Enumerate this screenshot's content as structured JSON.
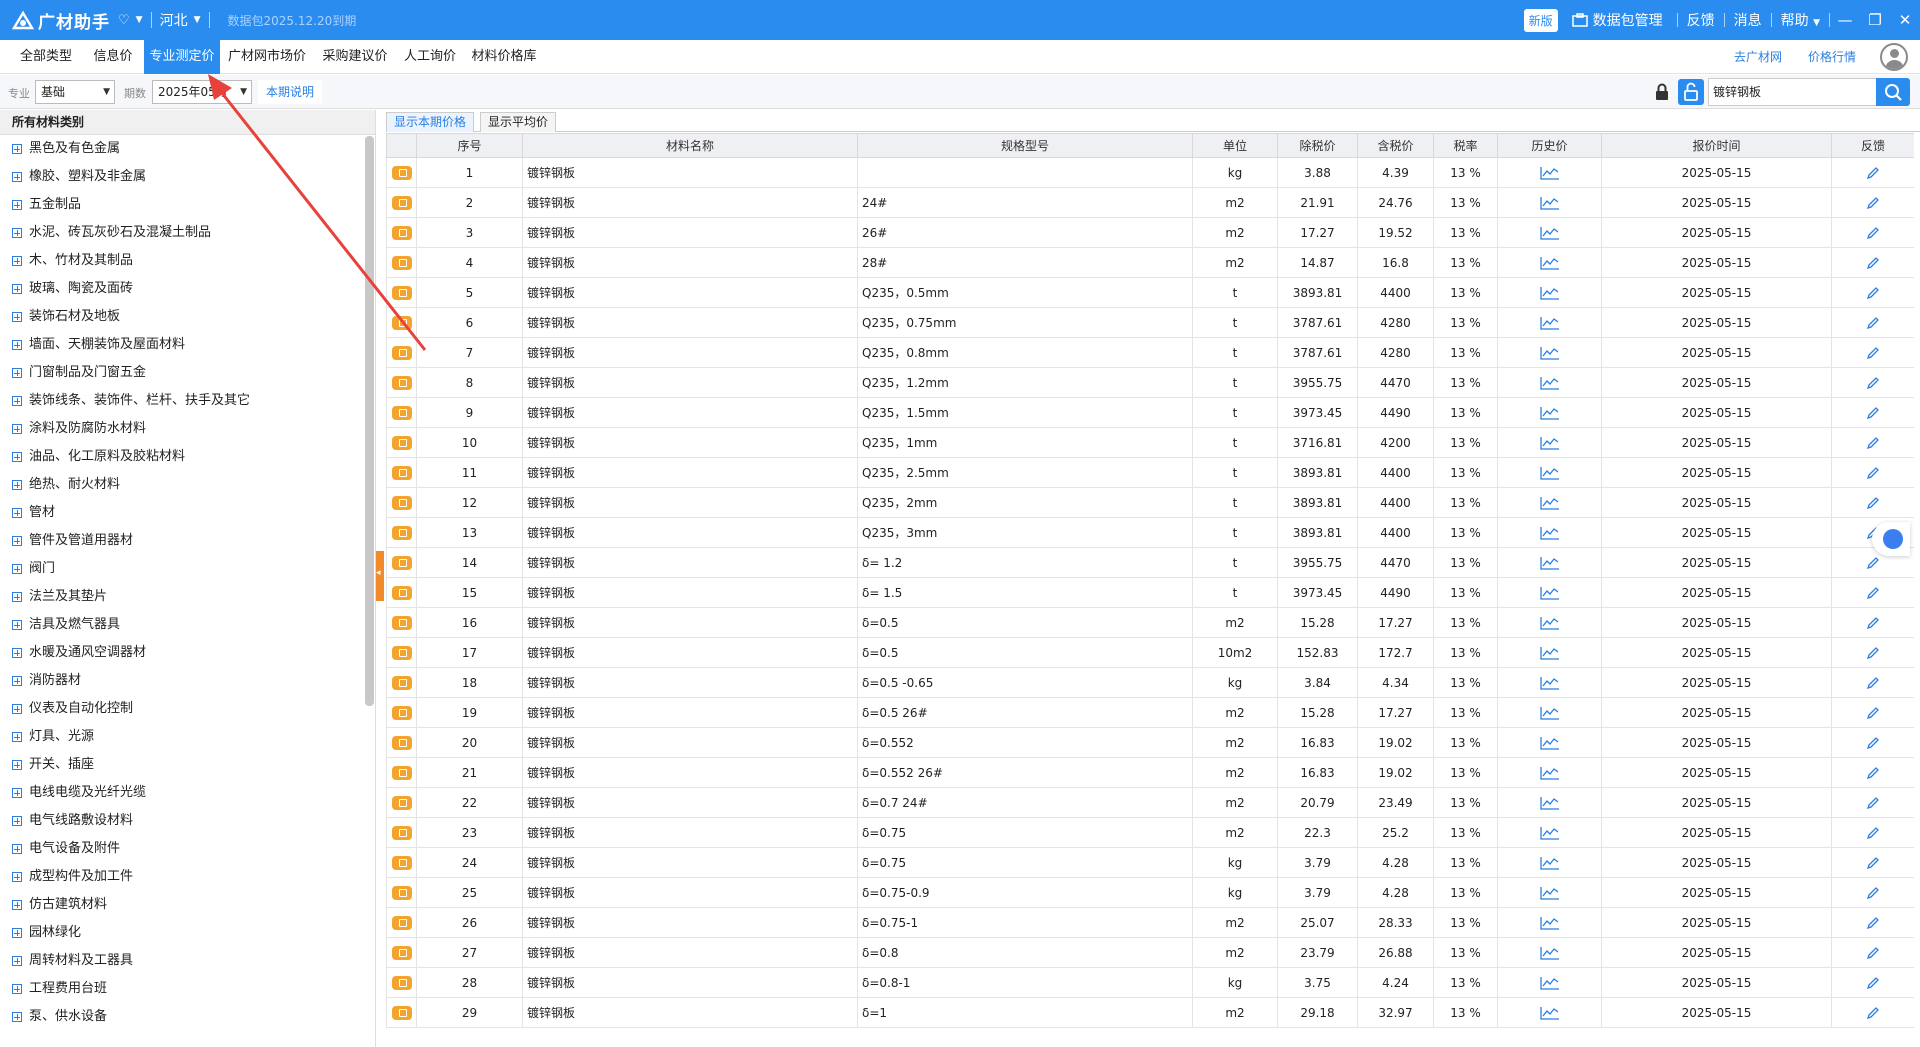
{
  "app": {
    "name": "广材助手",
    "region": "河北",
    "data_package_expire": "数据包2025.12.20到期",
    "new_badge": "新版",
    "data_package_manage": "数据包管理",
    "feedback": "反馈",
    "messages": "消息",
    "help": "帮助"
  },
  "menu": {
    "tabs": [
      "全部类型",
      "信息价",
      "专业测定价",
      "广材网市场价",
      "采购建议价",
      "人工询价",
      "材料价格库"
    ],
    "active_index": 2,
    "goto_site": "去广材网",
    "price_trend": "价格行情"
  },
  "filter": {
    "specialty_label": "专业",
    "specialty_value": "基础",
    "period_label": "期数",
    "period_value": "2025年05月",
    "explain_link": "本期说明",
    "search_value": "镀锌钢板"
  },
  "sidebar": {
    "title": "所有材料类别",
    "items": [
      "黑色及有色金属",
      "橡胶、塑料及非金属",
      "五金制品",
      "水泥、砖瓦灰砂石及混凝土制品",
      "木、竹材及其制品",
      "玻璃、陶瓷及面砖",
      "装饰石材及地板",
      "墙面、天棚装饰及屋面材料",
      "门窗制品及门窗五金",
      "装饰线条、装饰件、栏杆、扶手及其它",
      "涂料及防腐防水材料",
      "油品、化工原料及胶粘材料",
      "绝热、耐火材料",
      "管材",
      "管件及管道用器材",
      "阀门",
      "法兰及其垫片",
      "洁具及燃气器具",
      "水暖及通风空调器材",
      "消防器材",
      "仪表及自动化控制",
      "灯具、光源",
      "开关、插座",
      "电线电缆及光纤光缆",
      "电气线路敷设材料",
      "电气设备及附件",
      "成型构件及加工件",
      "仿古建筑材料",
      "园林绿化",
      "周转材料及工器具",
      "工程费用台班",
      "泵、供水设备"
    ]
  },
  "view_tabs": [
    "显示本期价格",
    "显示平均价"
  ],
  "table": {
    "headers": [
      "",
      "序号",
      "材料名称",
      "规格型号",
      "单位",
      "除税价",
      "含税价",
      "税率",
      "历史价",
      "报价时间",
      "反馈"
    ],
    "rows": [
      {
        "no": "1",
        "name": "镀锌钢板",
        "spec": "",
        "unit": "kg",
        "ex_tax": "3.88",
        "inc_tax": "4.39",
        "rate": "13 %",
        "date": "2025-05-15"
      },
      {
        "no": "2",
        "name": "镀锌钢板",
        "spec": "24#",
        "unit": "m2",
        "ex_tax": "21.91",
        "inc_tax": "24.76",
        "rate": "13 %",
        "date": "2025-05-15"
      },
      {
        "no": "3",
        "name": "镀锌钢板",
        "spec": "26#",
        "unit": "m2",
        "ex_tax": "17.27",
        "inc_tax": "19.52",
        "rate": "13 %",
        "date": "2025-05-15"
      },
      {
        "no": "4",
        "name": "镀锌钢板",
        "spec": "28#",
        "unit": "m2",
        "ex_tax": "14.87",
        "inc_tax": "16.8",
        "rate": "13 %",
        "date": "2025-05-15"
      },
      {
        "no": "5",
        "name": "镀锌钢板",
        "spec": "Q235，0.5mm",
        "unit": "t",
        "ex_tax": "3893.81",
        "inc_tax": "4400",
        "rate": "13 %",
        "date": "2025-05-15"
      },
      {
        "no": "6",
        "name": "镀锌钢板",
        "spec": "Q235，0.75mm",
        "unit": "t",
        "ex_tax": "3787.61",
        "inc_tax": "4280",
        "rate": "13 %",
        "date": "2025-05-15"
      },
      {
        "no": "7",
        "name": "镀锌钢板",
        "spec": "Q235，0.8mm",
        "unit": "t",
        "ex_tax": "3787.61",
        "inc_tax": "4280",
        "rate": "13 %",
        "date": "2025-05-15"
      },
      {
        "no": "8",
        "name": "镀锌钢板",
        "spec": "Q235，1.2mm",
        "unit": "t",
        "ex_tax": "3955.75",
        "inc_tax": "4470",
        "rate": "13 %",
        "date": "2025-05-15"
      },
      {
        "no": "9",
        "name": "镀锌钢板",
        "spec": "Q235，1.5mm",
        "unit": "t",
        "ex_tax": "3973.45",
        "inc_tax": "4490",
        "rate": "13 %",
        "date": "2025-05-15"
      },
      {
        "no": "10",
        "name": "镀锌钢板",
        "spec": "Q235，1mm",
        "unit": "t",
        "ex_tax": "3716.81",
        "inc_tax": "4200",
        "rate": "13 %",
        "date": "2025-05-15"
      },
      {
        "no": "11",
        "name": "镀锌钢板",
        "spec": "Q235，2.5mm",
        "unit": "t",
        "ex_tax": "3893.81",
        "inc_tax": "4400",
        "rate": "13 %",
        "date": "2025-05-15"
      },
      {
        "no": "12",
        "name": "镀锌钢板",
        "spec": "Q235，2mm",
        "unit": "t",
        "ex_tax": "3893.81",
        "inc_tax": "4400",
        "rate": "13 %",
        "date": "2025-05-15"
      },
      {
        "no": "13",
        "name": "镀锌钢板",
        "spec": "Q235，3mm",
        "unit": "t",
        "ex_tax": "3893.81",
        "inc_tax": "4400",
        "rate": "13 %",
        "date": "2025-05-15"
      },
      {
        "no": "14",
        "name": "镀锌钢板",
        "spec": "δ= 1.2",
        "unit": "t",
        "ex_tax": "3955.75",
        "inc_tax": "4470",
        "rate": "13 %",
        "date": "2025-05-15"
      },
      {
        "no": "15",
        "name": "镀锌钢板",
        "spec": "δ= 1.5",
        "unit": "t",
        "ex_tax": "3973.45",
        "inc_tax": "4490",
        "rate": "13 %",
        "date": "2025-05-15"
      },
      {
        "no": "16",
        "name": "镀锌钢板",
        "spec": "δ=0.5",
        "unit": "m2",
        "ex_tax": "15.28",
        "inc_tax": "17.27",
        "rate": "13 %",
        "date": "2025-05-15"
      },
      {
        "no": "17",
        "name": "镀锌钢板",
        "spec": "δ=0.5",
        "unit": "10m2",
        "ex_tax": "152.83",
        "inc_tax": "172.7",
        "rate": "13 %",
        "date": "2025-05-15"
      },
      {
        "no": "18",
        "name": "镀锌钢板",
        "spec": "δ=0.5 -0.65",
        "unit": "kg",
        "ex_tax": "3.84",
        "inc_tax": "4.34",
        "rate": "13 %",
        "date": "2025-05-15"
      },
      {
        "no": "19",
        "name": "镀锌钢板",
        "spec": "δ=0.5 26#",
        "unit": "m2",
        "ex_tax": "15.28",
        "inc_tax": "17.27",
        "rate": "13 %",
        "date": "2025-05-15"
      },
      {
        "no": "20",
        "name": "镀锌钢板",
        "spec": "δ=0.552",
        "unit": "m2",
        "ex_tax": "16.83",
        "inc_tax": "19.02",
        "rate": "13 %",
        "date": "2025-05-15"
      },
      {
        "no": "21",
        "name": "镀锌钢板",
        "spec": "δ=0.552 26#",
        "unit": "m2",
        "ex_tax": "16.83",
        "inc_tax": "19.02",
        "rate": "13 %",
        "date": "2025-05-15"
      },
      {
        "no": "22",
        "name": "镀锌钢板",
        "spec": "δ=0.7 24#",
        "unit": "m2",
        "ex_tax": "20.79",
        "inc_tax": "23.49",
        "rate": "13 %",
        "date": "2025-05-15"
      },
      {
        "no": "23",
        "name": "镀锌钢板",
        "spec": "δ=0.75",
        "unit": "m2",
        "ex_tax": "22.3",
        "inc_tax": "25.2",
        "rate": "13 %",
        "date": "2025-05-15"
      },
      {
        "no": "24",
        "name": "镀锌钢板",
        "spec": "δ=0.75",
        "unit": "kg",
        "ex_tax": "3.79",
        "inc_tax": "4.28",
        "rate": "13 %",
        "date": "2025-05-15"
      },
      {
        "no": "25",
        "name": "镀锌钢板",
        "spec": "δ=0.75-0.9",
        "unit": "kg",
        "ex_tax": "3.79",
        "inc_tax": "4.28",
        "rate": "13 %",
        "date": "2025-05-15"
      },
      {
        "no": "26",
        "name": "镀锌钢板",
        "spec": "δ=0.75-1",
        "unit": "m2",
        "ex_tax": "25.07",
        "inc_tax": "28.33",
        "rate": "13 %",
        "date": "2025-05-15"
      },
      {
        "no": "27",
        "name": "镀锌钢板",
        "spec": "δ=0.8",
        "unit": "m2",
        "ex_tax": "23.79",
        "inc_tax": "26.88",
        "rate": "13 %",
        "date": "2025-05-15"
      },
      {
        "no": "28",
        "name": "镀锌钢板",
        "spec": "δ=0.8-1",
        "unit": "kg",
        "ex_tax": "3.75",
        "inc_tax": "4.24",
        "rate": "13 %",
        "date": "2025-05-15"
      },
      {
        "no": "29",
        "name": "镀锌钢板",
        "spec": "δ=1",
        "unit": "m2",
        "ex_tax": "29.18",
        "inc_tax": "32.97",
        "rate": "13 %",
        "date": "2025-05-15"
      }
    ]
  },
  "icons": {
    "badge": "specialty-badge-icon",
    "history": "trend-chart-icon",
    "feedback": "pencil-icon",
    "lock": "lock-icon",
    "search": "search-icon"
  },
  "colors": {
    "primary": "#2b8cf0",
    "badge": "#f2a42c",
    "link": "#2b7fe0",
    "annotation_arrow": "#e8413c"
  }
}
